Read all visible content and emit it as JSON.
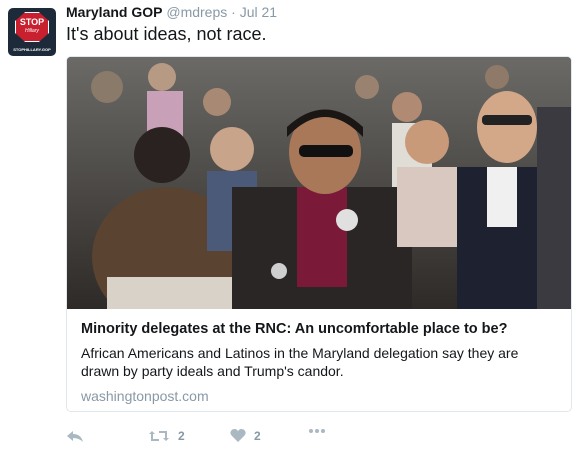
{
  "tweet": {
    "author_name": "Maryland GOP",
    "handle": "@mdreps",
    "separator": "·",
    "date": "Jul 21",
    "text": "It's about ideas, not race."
  },
  "avatar": {
    "sign_text": "STOP",
    "sign_subtext": "Hillary",
    "footer_text": "STOPHILLARY.GOP",
    "sign_color": "#c8202f"
  },
  "card": {
    "title": "Minority delegates at the RNC: An uncomfortable place to be?",
    "description": "African Americans and Latinos in the Maryland delegation say they are drawn by party ideals and Trump's candor.",
    "domain": "washingtonpost.com"
  },
  "actions": {
    "reply_icon": "reply-icon",
    "retweet_icon": "retweet-icon",
    "retweet_count": "2",
    "like_icon": "heart-icon",
    "like_count": "2",
    "more_icon": "more-dots-icon"
  },
  "colors": {
    "text": "#14171a",
    "secondary": "#8899a6",
    "border": "#e1e8ed"
  }
}
